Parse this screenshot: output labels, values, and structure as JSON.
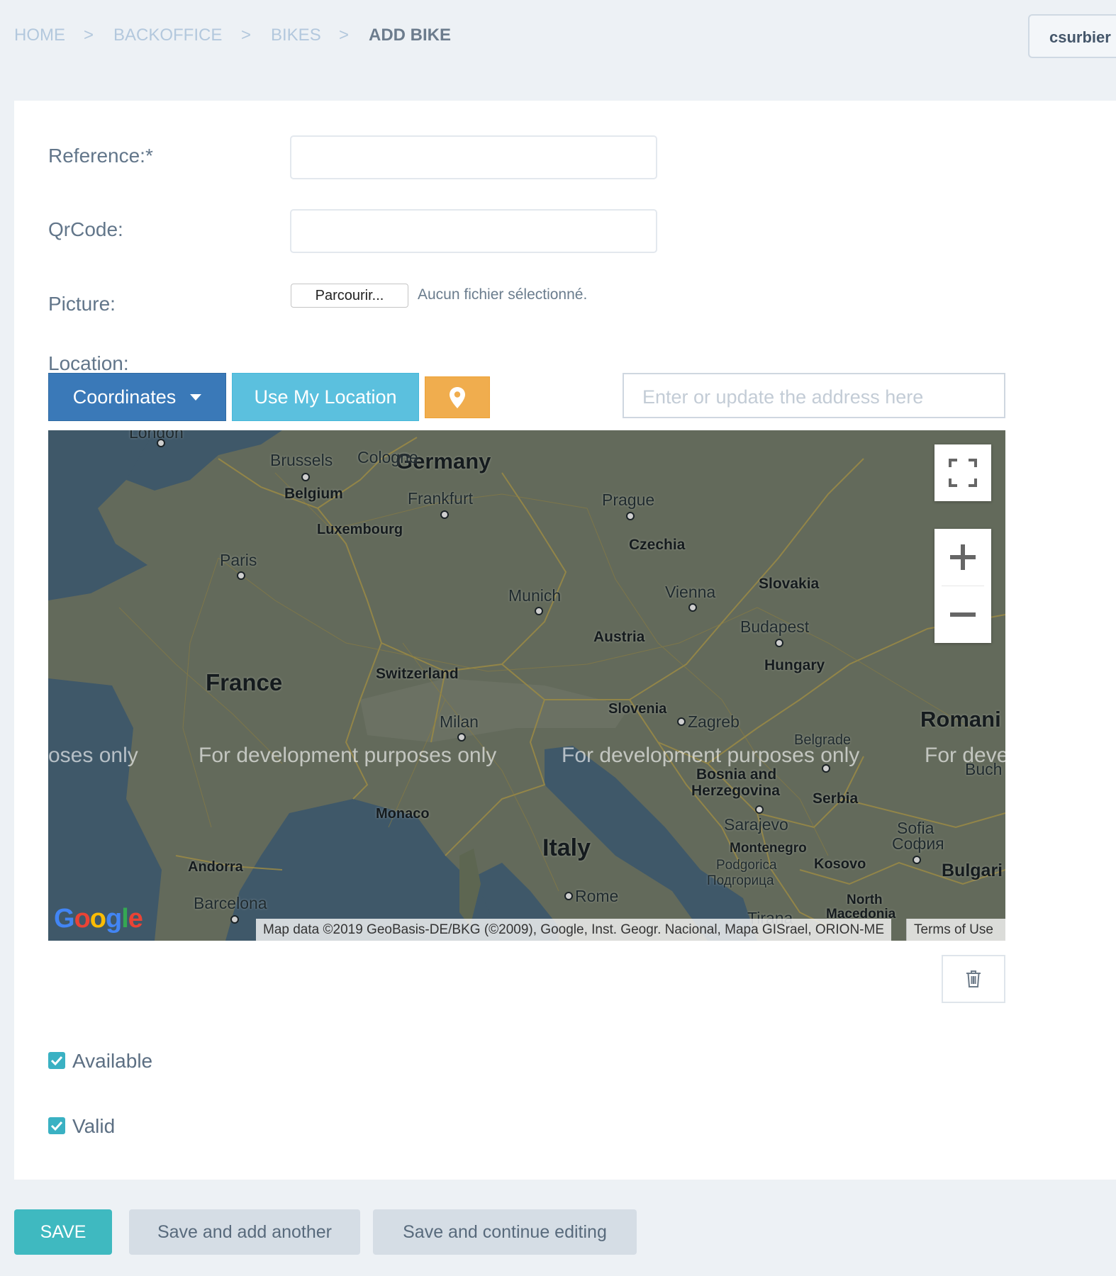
{
  "breadcrumb": {
    "items": [
      "HOME",
      "BACKOFFICE",
      "BIKES"
    ],
    "current": "ADD BIKE",
    "separator": ">"
  },
  "user": {
    "name": "csurbier"
  },
  "form": {
    "reference_label": "Reference:*",
    "qrcode_label": "QrCode:",
    "picture_label": "Picture:",
    "browse_label": "Parcourir...",
    "file_status": "Aucun fichier sélectionné.",
    "location_label": "Location:",
    "coordinates_label": "Coordinates",
    "use_my_location_label": "Use My Location",
    "address_placeholder": "Enter or update the address here",
    "available_label": "Available",
    "available_checked": true,
    "valid_label": "Valid",
    "valid_checked": true
  },
  "map": {
    "cities": [
      "London",
      "Brussels",
      "Cologne",
      "Frankfurt",
      "Prague",
      "Paris",
      "Munich",
      "Vienna",
      "Budapest",
      "Milan",
      "Zagreb",
      "Belgrade",
      "Buch",
      "Sarajevo",
      "Podgorica",
      "Подгорица",
      "Sofia",
      "София",
      "Rome",
      "Barcelona",
      "Tirana"
    ],
    "countries": [
      "Germany",
      "Belgium",
      "Luxembourg",
      "Czechia",
      "Slovakia",
      "Austria",
      "Hungary",
      "France",
      "Switzerland",
      "Slovenia",
      "Romani",
      "Bosnia and",
      "Herzegovina",
      "Serbia",
      "Monaco",
      "Italy",
      "Montenegro",
      "Kosovo",
      "Bulgari",
      "Andorra",
      "North",
      "Macedonia"
    ],
    "watermark": [
      "oses only",
      "For development purposes only",
      "For development purposes only",
      "For deve"
    ],
    "attribution": "Map data ©2019 GeoBasis-DE/BKG (©2009), Google, Inst. Geogr. Nacional, Mapa GISrael, ORION-ME",
    "terms": "Terms of Use",
    "logo": "Google"
  },
  "actions": {
    "save": "SAVE",
    "save_add": "Save and add another",
    "save_continue": "Save and continue editing"
  },
  "colors": {
    "primary": "#3a79b8",
    "info": "#5bc0de",
    "warning": "#f0ad4e",
    "teal": "#3fb9c0"
  }
}
